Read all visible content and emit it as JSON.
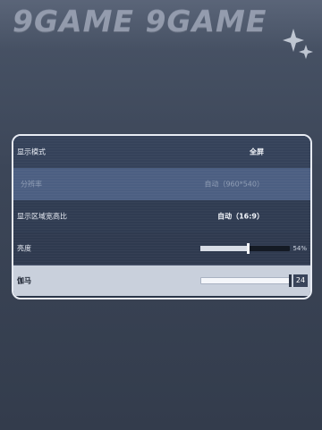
{
  "watermark": {
    "text": "9GAME 9GAME"
  },
  "settings": {
    "rows": [
      {
        "label": "显示模式",
        "value": "全屏",
        "enabled": true
      },
      {
        "label": "分辨率",
        "value": "自动（960*540）",
        "enabled": false
      },
      {
        "label": "显示区域宽高比",
        "value": "自动（16:9）",
        "enabled": true
      },
      {
        "label": "亮度",
        "slider_percent": 54,
        "value_text": "54%"
      },
      {
        "label": "伽马",
        "slider_percent": 100,
        "value_text": "24",
        "selected": true
      }
    ]
  },
  "colors": {
    "panel_border": "#e8ecf4",
    "selected_row": "#c9d0dc",
    "background": "#3c4658"
  }
}
